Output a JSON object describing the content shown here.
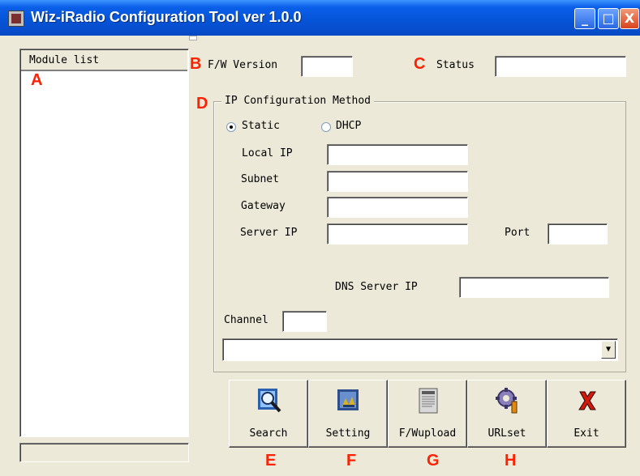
{
  "window": {
    "title": "Wiz-iRadio Configuration Tool ver 1.0.0",
    "controls": {
      "minimize": "_",
      "maximize": "□",
      "close": "X"
    }
  },
  "module_list": {
    "header": "Module list",
    "items": []
  },
  "firmware": {
    "label": "F/W Version",
    "value": ""
  },
  "status": {
    "label": "Status",
    "value": ""
  },
  "ip_config": {
    "legend": "IP Configuration Method",
    "static_label": "Static",
    "dhcp_label": "DHCP",
    "selected": "Static",
    "local_ip_label": "Local IP",
    "local_ip": "",
    "subnet_label": "Subnet",
    "subnet": "",
    "gateway_label": "Gateway",
    "gateway": "",
    "server_ip_label": "Server IP",
    "server_ip": "",
    "port_label": "Port",
    "port": "",
    "dns_label": "DNS Server IP",
    "dns": ""
  },
  "channel": {
    "label": "Channel",
    "value": ""
  },
  "combo": {
    "value": ""
  },
  "toolbar": {
    "search": "Search",
    "setting": "Setting",
    "fwupload": "F/Wupload",
    "urlset": "URLset",
    "exit": "Exit"
  },
  "markers": {
    "a": "A",
    "b": "B",
    "c": "C",
    "d": "D",
    "e": "E",
    "f": "F",
    "g": "G",
    "h": "H"
  },
  "colors": {
    "title_bar": "#0553d6",
    "marker": "#ff2200",
    "window_bg": "#ece9d8"
  }
}
